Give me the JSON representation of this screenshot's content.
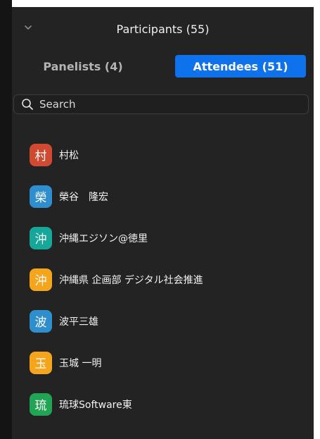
{
  "header": {
    "title": "Participants (55)"
  },
  "tabs": {
    "panelists": "Panelists (4)",
    "attendees": "Attendees (51)"
  },
  "search": {
    "placeholder": "Search"
  },
  "attendees": [
    {
      "avatar_char": "村",
      "name": "村松",
      "color": "#d04a32"
    },
    {
      "avatar_char": "榮",
      "name": "榮谷　隆宏",
      "color": "#2f8fce"
    },
    {
      "avatar_char": "沖",
      "name": "沖縄エジソン@徳里",
      "color": "#17a69a"
    },
    {
      "avatar_char": "沖",
      "name": "沖縄県 企画部 デジタル社会推進",
      "color": "#f4a51c"
    },
    {
      "avatar_char": "波",
      "name": "波平三雄",
      "color": "#2f8fce"
    },
    {
      "avatar_char": "玉",
      "name": "玉城 一明",
      "color": "#f4a51c"
    },
    {
      "avatar_char": "琉",
      "name": "琉球Software東",
      "color": "#22a455"
    }
  ],
  "colors": {
    "accent": "#0e72ed",
    "panel_bg": "#232323"
  }
}
